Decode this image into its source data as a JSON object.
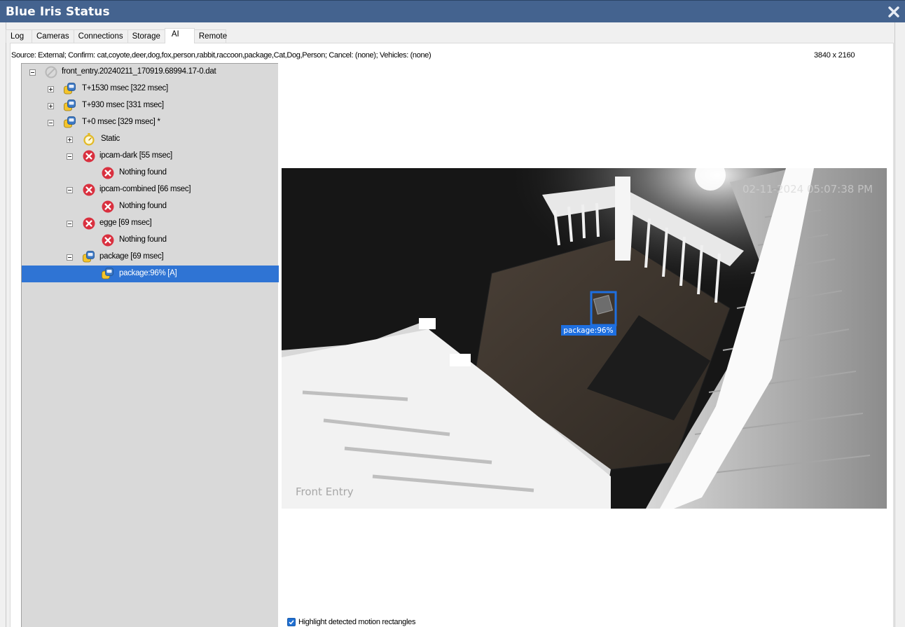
{
  "window": {
    "title": "Blue Iris Status"
  },
  "tabs": [
    {
      "label": "Log"
    },
    {
      "label": "Cameras"
    },
    {
      "label": "Connections"
    },
    {
      "label": "Storage"
    },
    {
      "label": "AI",
      "active": true
    },
    {
      "label": "Remote"
    }
  ],
  "ai": {
    "source_line": "Source: External; Confirm: cat,coyote,deer,dog,fox,person,rabbit,raccoon,package,Cat,Dog,Person; Cancel: (none); Vehicles: (none)",
    "resolution": "3840 x 2160",
    "tree": {
      "root": "front_entry.20240211_170919.68994.17-0.dat",
      "frames": [
        {
          "label": "T+1530 msec  [322 msec]"
        },
        {
          "label": "T+930 msec  [331 msec]"
        },
        {
          "label": "T+0 msec  [329 msec]  *"
        }
      ],
      "static": "Static",
      "models": [
        {
          "label": "ipcam-dark [55 msec]",
          "result": "Nothing found"
        },
        {
          "label": "ipcam-combined [66 msec]",
          "result": "Nothing found"
        },
        {
          "label": "egge [69 msec]",
          "result": "Nothing found"
        },
        {
          "label": "package [69 msec]",
          "result": "package:96% [A]"
        }
      ]
    },
    "image": {
      "timestamp": "02-11-2024 05:07:38 PM",
      "camera_name": "Front Entry",
      "detection_label": "package:96%"
    },
    "highlight_checkbox": {
      "label": "Highlight detected motion rectangles",
      "checked": true
    }
  },
  "colors": {
    "titlebar": "#44638f",
    "selection": "#2f74d4",
    "detection_box": "#1e6fe0",
    "error_icon": "#d9303f"
  }
}
